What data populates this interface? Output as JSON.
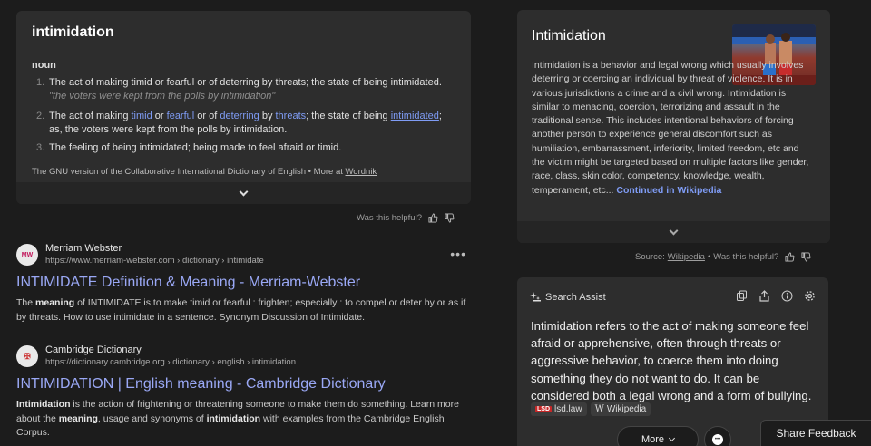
{
  "dictionary": {
    "word": "intimidation",
    "part_of_speech": "noun",
    "definitions": [
      {
        "number": "1.",
        "text": "The act of making timid or fearful or of deterring by threats; the state of being intimidated.",
        "example": "\"the voters were kept from the polls by intimidation\""
      },
      {
        "number": "2.",
        "p1": "The act of making ",
        "w1": "timid",
        "p2": " or ",
        "w2": "fearful",
        "p3": " or of ",
        "w3": "deterring",
        "p4": " by ",
        "w4": "threats",
        "p5": "; the state of being ",
        "w5": "intimidated",
        "p6": "; as, the voters were kept from the polls by intimidation."
      },
      {
        "number": "3.",
        "text": "The feeling of being intimidated; being made to feel afraid or timid."
      }
    ],
    "source": "The GNU version of the Collaborative International Dictionary of English",
    "more_at": "More at",
    "more_at_link": "Wordnik"
  },
  "helpful": {
    "label": "Was this helpful?",
    "source_prefix": "Source:",
    "source_link": "Wikipedia",
    "source_sep": "•"
  },
  "results": [
    {
      "site_name": "Merriam Webster",
      "favicon_text": "MW",
      "url": "https://www.merriam-webster.com › dictionary › intimidate",
      "title": "INTIMIDATE Definition & Meaning - Merriam-Webster",
      "s1": "The ",
      "b1": "meaning",
      "s2": " of INTIMIDATE is to make timid or fearful : frighten; especially : to compel or deter by or as if by threats. How to use intimidate in a sentence. Synonym Discussion of Intimidate."
    },
    {
      "site_name": "Cambridge Dictionary",
      "favicon_text": "✠",
      "url": "https://dictionary.cambridge.org › dictionary › english › intimidation",
      "title": "INTIMIDATION | English meaning - Cambridge Dictionary",
      "b1": "Intimidation",
      "s1": " is the action of frightening or threatening someone to make them do something. Learn more about the ",
      "b2": "meaning",
      "s2": ", usage and synonyms of ",
      "b3": "intimidation",
      "s3": " with examples from the Cambridge English Corpus."
    }
  ],
  "wiki": {
    "title": "Intimidation",
    "text": "Intimidation is a behavior and legal wrong which usually involves deterring or coercing an individual by threat of violence. It is in various jurisdictions a crime and a civil wrong. Intimidation is similar to menacing, coercion, terrorizing and assault in the traditional sense. This includes intentional behaviors of forcing another person to experience general discomfort such as humiliation, embarrassment, inferiority, limited freedom, etc and the victim might be targeted based on multiple factors like gender, race, class, skin color, competency, knowledge, wealth, temperament, etc...",
    "continue": "Continued in Wikipedia"
  },
  "assist": {
    "header": "Search Assist",
    "answer": "Intimidation refers to the act of making someone feel afraid or apprehensive, often through threats or aggressive behavior, to coerce them into doing something they do not want to do. It can be considered both a legal wrong and a form of bullying.",
    "sources": [
      {
        "badge": "LSD",
        "label": "lsd.law"
      },
      {
        "badge": "W",
        "label": "Wikipedia"
      }
    ],
    "more_label": "More"
  },
  "share_feedback": "Share Feedback"
}
